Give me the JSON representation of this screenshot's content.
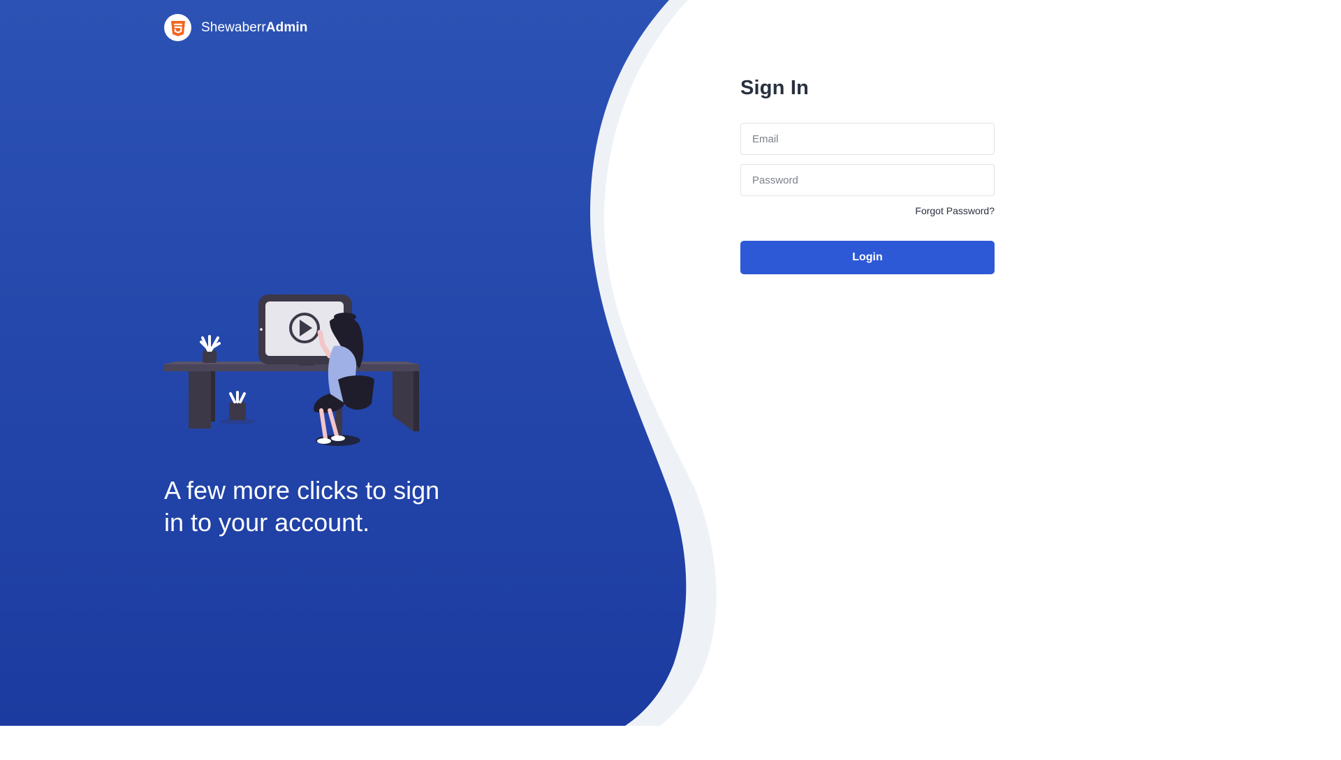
{
  "brand": {
    "name_regular": "Shewaberr",
    "name_bold": "Admin",
    "logo_icon": "html5-shield-icon",
    "logo_color": "#f26522"
  },
  "hero": {
    "tagline": "A few more clicks to sign in to your account.",
    "illustration": "woman-at-desk-video-illustration",
    "gradient_top": "#2c52b5",
    "gradient_bottom": "#1c3ba0"
  },
  "form": {
    "title": "Sign In",
    "email_placeholder": "Email",
    "password_placeholder": "Password",
    "forgot_label": "Forgot Password?",
    "login_label": "Login",
    "accent": "#2d59d6"
  }
}
